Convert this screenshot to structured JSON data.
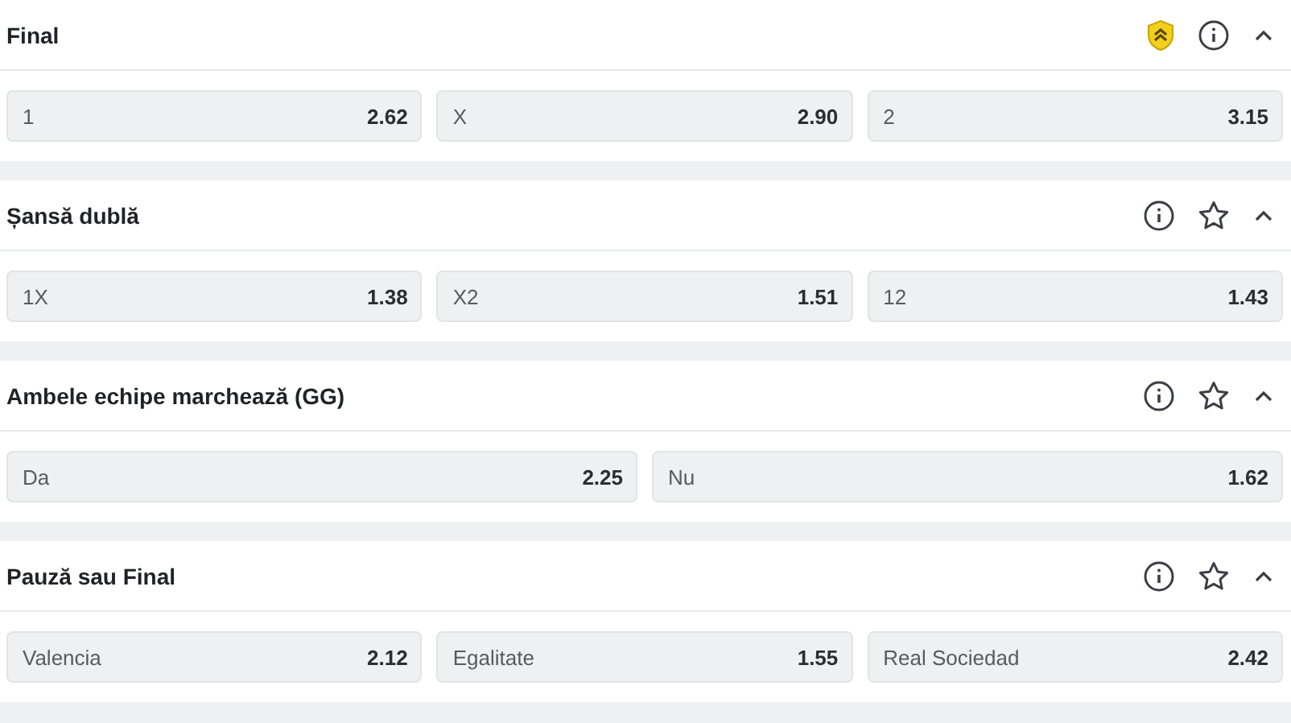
{
  "markets": [
    {
      "title": "Final",
      "favorite": true,
      "expanded": true,
      "odds": [
        {
          "label": "1",
          "value": "2.62"
        },
        {
          "label": "X",
          "value": "2.90"
        },
        {
          "label": "2",
          "value": "3.15"
        }
      ]
    },
    {
      "title": "Șansă dublă",
      "favorite": false,
      "expanded": true,
      "odds": [
        {
          "label": "1X",
          "value": "1.38"
        },
        {
          "label": "X2",
          "value": "1.51"
        },
        {
          "label": "12",
          "value": "1.43"
        }
      ]
    },
    {
      "title": "Ambele echipe marchează (GG)",
      "favorite": false,
      "expanded": true,
      "odds": [
        {
          "label": "Da",
          "value": "2.25"
        },
        {
          "label": "Nu",
          "value": "1.62"
        }
      ]
    },
    {
      "title": "Pauză sau Final",
      "favorite": false,
      "expanded": true,
      "odds": [
        {
          "label": "Valencia",
          "value": "2.12"
        },
        {
          "label": "Egalitate",
          "value": "1.55"
        },
        {
          "label": "Real Sociedad",
          "value": "2.42"
        }
      ]
    }
  ]
}
